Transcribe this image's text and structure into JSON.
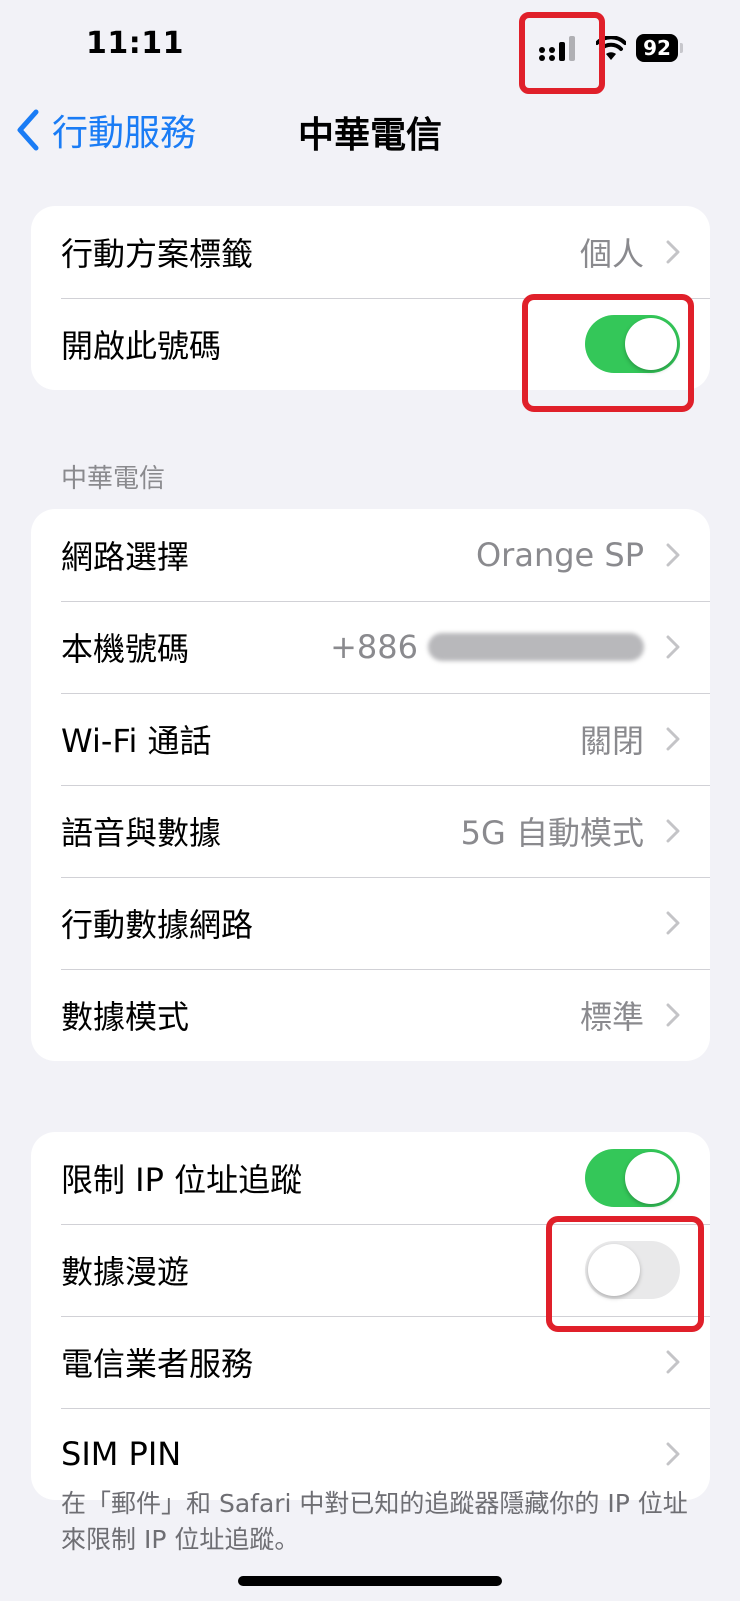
{
  "status_bar": {
    "time": "11:11",
    "battery": "92"
  },
  "nav": {
    "back_label": "行動服務",
    "title": "中華電信"
  },
  "group1": {
    "rows": [
      {
        "label": "行動方案標籤",
        "value": "個人"
      },
      {
        "label": "開啟此號碼",
        "toggle": true
      }
    ]
  },
  "section": {
    "header": "中華電信"
  },
  "group2": {
    "rows": [
      {
        "label": "網路選擇",
        "value": "Orange SP"
      },
      {
        "label": "本機號碼",
        "value": "+886"
      },
      {
        "label": "Wi-Fi 通話",
        "value": "關閉"
      },
      {
        "label": "語音與數據",
        "value": "5G 自動模式"
      },
      {
        "label": "行動數據網路"
      },
      {
        "label": "數據模式",
        "value": "標準"
      }
    ]
  },
  "group3": {
    "rows": [
      {
        "label": "限制 IP 位址追蹤",
        "toggle": true
      },
      {
        "label": "數據漫遊",
        "toggle": false
      },
      {
        "label": "電信業者服務"
      },
      {
        "label": "SIM PIN"
      }
    ]
  },
  "footer": {
    "text": "在「郵件」和 Safari 中對已知的追蹤器隱藏你的 IP 位址來限制 IP 位址追蹤。"
  },
  "colors": {
    "accent": "#1a7cf5",
    "toggle_on": "#34c759",
    "annotation": "#e0202a"
  }
}
